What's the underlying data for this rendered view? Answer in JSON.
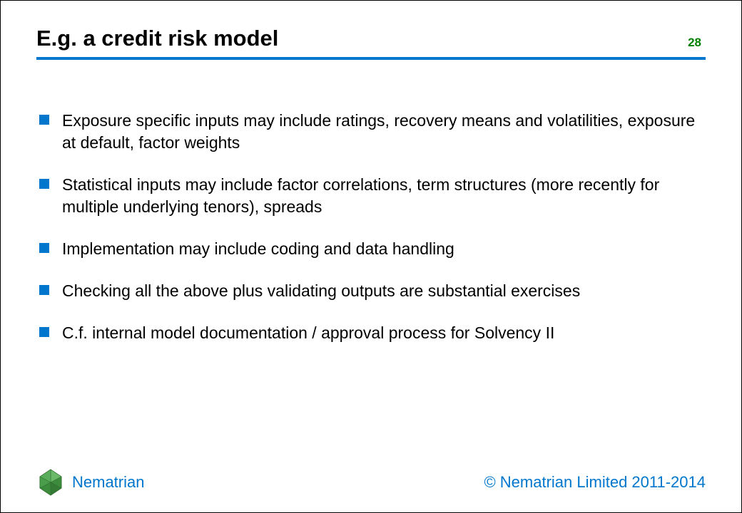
{
  "header": {
    "title": "E.g. a credit risk model",
    "page_number": "28"
  },
  "bullets": [
    "Exposure specific inputs may include ratings, recovery means and volatilities, exposure at default, factor weights",
    "Statistical inputs may include factor correlations, term structures (more recently for multiple underlying tenors), spreads",
    "Implementation may include coding and data handling",
    "Checking all the above plus validating outputs are substantial exercises",
    "C.f. internal model documentation / approval process for Solvency II"
  ],
  "footer": {
    "brand": "Nematrian",
    "copyright": "© Nematrian Limited 2011-2014"
  },
  "colors": {
    "accent": "#0077cc",
    "page_number": "#008000"
  }
}
